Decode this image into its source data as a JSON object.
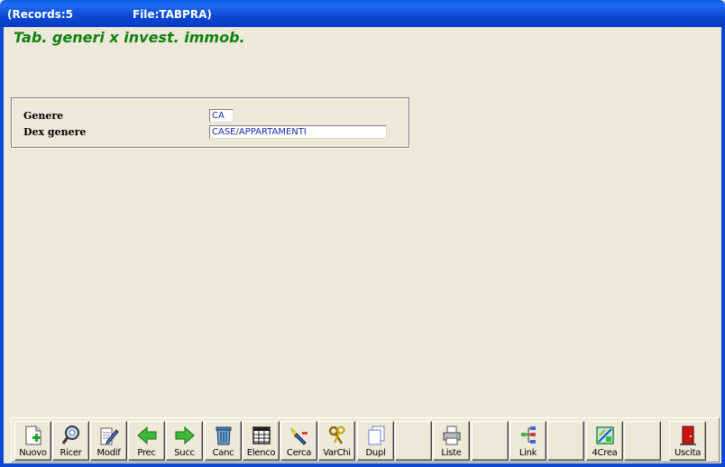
{
  "window": {
    "records": "(Records:5",
    "file": "File:TABPRA)"
  },
  "form": {
    "title": "Tab. generi x invest. immob.",
    "fields": [
      {
        "label": "Genere",
        "value": "CA"
      },
      {
        "label": "Dex genere",
        "value": "CASE/APPARTAMENTI"
      }
    ]
  },
  "toolbar": {
    "buttons": [
      {
        "label": "Nuovo",
        "icon": "new-document-icon"
      },
      {
        "label": "Ricer",
        "icon": "magnifier-icon"
      },
      {
        "label": "Modif",
        "icon": "edit-document-icon"
      },
      {
        "label": "Prec",
        "icon": "arrow-left-icon"
      },
      {
        "label": "Succ",
        "icon": "arrow-right-icon"
      },
      {
        "label": "Canc",
        "icon": "trash-icon"
      },
      {
        "label": "Elenco",
        "icon": "table-icon"
      },
      {
        "label": "Cerca",
        "icon": "flashlight-icon"
      },
      {
        "label": "VarChi",
        "icon": "keys-icon"
      },
      {
        "label": "Dupl",
        "icon": "duplicate-icon"
      },
      {
        "label": "",
        "icon": ""
      },
      {
        "label": "Liste",
        "icon": "printer-icon"
      },
      {
        "label": "",
        "icon": ""
      },
      {
        "label": "Link",
        "icon": "tree-icon"
      },
      {
        "label": "",
        "icon": ""
      },
      {
        "label": "4Crea",
        "icon": "builder-icon"
      },
      {
        "label": "",
        "icon": ""
      },
      {
        "label": "Uscita",
        "icon": "exit-door-icon"
      }
    ]
  }
}
